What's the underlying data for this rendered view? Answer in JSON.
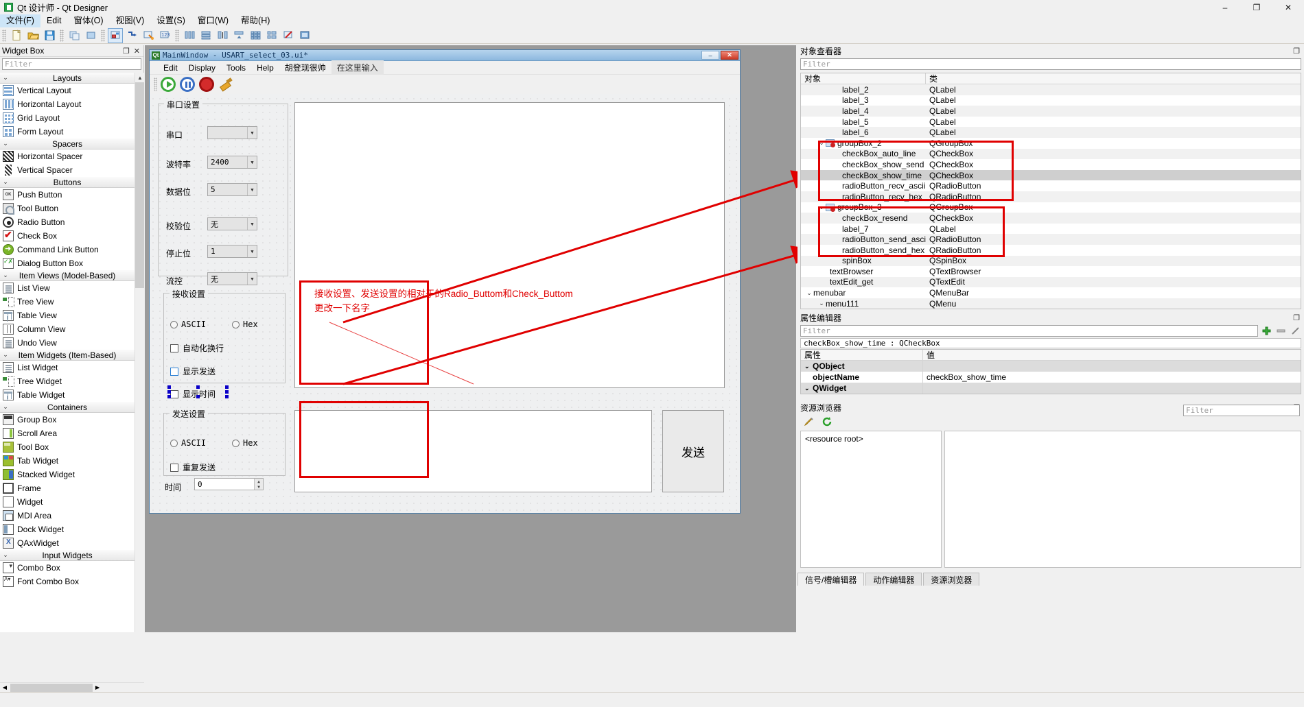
{
  "window": {
    "title": "Qt 设计师 - Qt Designer",
    "app_icon": "qt-designer-icon",
    "minimize": "–",
    "maximize": "❐",
    "close": "✕"
  },
  "menubar": [
    {
      "label": "文件(F)",
      "active": true
    },
    {
      "label": "Edit",
      "active": false
    },
    {
      "label": "窗体(O)",
      "active": false
    },
    {
      "label": "视图(V)",
      "active": false
    },
    {
      "label": "设置(S)",
      "active": false
    },
    {
      "label": "窗口(W)",
      "active": false
    },
    {
      "label": "帮助(H)",
      "active": false
    }
  ],
  "widget_box": {
    "title": "Widget Box",
    "float_btn": "❐",
    "close_btn": "✕",
    "filter_placeholder": "Filter",
    "categories": [
      {
        "label": "Layouts",
        "chevron": "⌄",
        "items": [
          {
            "label": "Vertical Layout",
            "icon": "vertical-layout-icon",
            "cls": "ic-vlayout"
          },
          {
            "label": "Horizontal Layout",
            "icon": "horizontal-layout-icon",
            "cls": "ic-hlayout"
          },
          {
            "label": "Grid Layout",
            "icon": "grid-layout-icon",
            "cls": "ic-grid"
          },
          {
            "label": "Form Layout",
            "icon": "form-layout-icon",
            "cls": "ic-form"
          }
        ]
      },
      {
        "label": "Spacers",
        "chevron": "⌄",
        "items": [
          {
            "label": "Horizontal Spacer",
            "icon": "horizontal-spacer-icon",
            "cls": "ic-hspacer"
          },
          {
            "label": "Vertical Spacer",
            "icon": "vertical-spacer-icon",
            "cls": "ic-vspacer"
          }
        ]
      },
      {
        "label": "Buttons",
        "chevron": "⌄",
        "items": [
          {
            "label": "Push Button",
            "icon": "push-button-icon",
            "cls": "ic-push",
            "glyph": "OK"
          },
          {
            "label": "Tool Button",
            "icon": "tool-button-icon",
            "cls": "ic-tool"
          },
          {
            "label": "Radio Button",
            "icon": "radio-button-icon",
            "cls": "ic-radio"
          },
          {
            "label": "Check Box",
            "icon": "check-box-icon",
            "cls": "ic-check"
          },
          {
            "label": "Command Link Button",
            "icon": "command-link-button-icon",
            "cls": "ic-cmd"
          },
          {
            "label": "Dialog Button Box",
            "icon": "dialog-button-box-icon",
            "cls": "ic-dlg"
          }
        ]
      },
      {
        "label": "Item Views (Model-Based)",
        "chevron": "⌄",
        "items": [
          {
            "label": "List View",
            "icon": "list-view-icon",
            "cls": "ic-listv"
          },
          {
            "label": "Tree View",
            "icon": "tree-view-icon",
            "cls": "ic-treev"
          },
          {
            "label": "Table View",
            "icon": "table-view-icon",
            "cls": "ic-tablev"
          },
          {
            "label": "Column View",
            "icon": "column-view-icon",
            "cls": "ic-colv"
          },
          {
            "label": "Undo View",
            "icon": "undo-view-icon",
            "cls": "ic-listv"
          }
        ]
      },
      {
        "label": "Item Widgets (Item-Based)",
        "chevron": "⌄",
        "items": [
          {
            "label": "List Widget",
            "icon": "list-widget-icon",
            "cls": "ic-listv"
          },
          {
            "label": "Tree Widget",
            "icon": "tree-widget-icon",
            "cls": "ic-treev"
          },
          {
            "label": "Table Widget",
            "icon": "table-widget-icon",
            "cls": "ic-tablev"
          }
        ]
      },
      {
        "label": "Containers",
        "chevron": "⌄",
        "items": [
          {
            "label": "Group Box",
            "icon": "group-box-icon",
            "cls": "ic-group"
          },
          {
            "label": "Scroll Area",
            "icon": "scroll-area-icon",
            "cls": "ic-scroll"
          },
          {
            "label": "Tool Box",
            "icon": "tool-box-icon",
            "cls": "ic-toolbox"
          },
          {
            "label": "Tab Widget",
            "icon": "tab-widget-icon",
            "cls": "ic-tab"
          },
          {
            "label": "Stacked Widget",
            "icon": "stacked-widget-icon",
            "cls": "ic-stacked"
          },
          {
            "label": "Frame",
            "icon": "frame-icon",
            "cls": "ic-frame"
          },
          {
            "label": "Widget",
            "icon": "widget-icon",
            "cls": "ic-widget"
          },
          {
            "label": "MDI Area",
            "icon": "mdi-area-icon",
            "cls": "ic-mdi"
          },
          {
            "label": "Dock Widget",
            "icon": "dock-widget-icon",
            "cls": "ic-dock"
          },
          {
            "label": "QAxWidget",
            "icon": "qaxwidget-icon",
            "cls": "ic-qax"
          }
        ]
      },
      {
        "label": "Input Widgets",
        "chevron": "⌄",
        "items": [
          {
            "label": "Combo Box",
            "icon": "combo-box-icon",
            "cls": "ic-combo"
          },
          {
            "label": "Font Combo Box",
            "icon": "font-combo-box-icon",
            "cls": "ic-fcombo"
          }
        ]
      }
    ]
  },
  "form_window": {
    "title": "MainWindow - USART_select_03.ui*",
    "qt_badge": "Qt",
    "minimize": "–",
    "close": "✕",
    "menus": [
      {
        "label": "Edit",
        "placeholder": false
      },
      {
        "label": "Display",
        "placeholder": false
      },
      {
        "label": "Tools",
        "placeholder": false
      },
      {
        "label": "Help",
        "placeholder": false
      },
      {
        "label": "胡登现很帅",
        "placeholder": false
      },
      {
        "label": "在这里输入",
        "placeholder": true
      }
    ],
    "toolbar": [
      {
        "name": "play-button",
        "icon": "play-icon"
      },
      {
        "name": "pause-button",
        "icon": "pause-icon"
      },
      {
        "name": "stop-button",
        "icon": "record-stop-icon"
      },
      {
        "name": "clear-button",
        "icon": "broom-icon"
      }
    ],
    "serial_group": {
      "title": "串口设置",
      "rows": [
        {
          "label": "串口",
          "value": ""
        },
        {
          "label": "波特率",
          "value": "2400"
        },
        {
          "label": "数据位",
          "value": "5"
        },
        {
          "label": "校验位",
          "value": "无"
        },
        {
          "label": "停止位",
          "value": "1"
        },
        {
          "label": "流控",
          "value": "无"
        }
      ]
    },
    "recv_group": {
      "title": "接收设置",
      "radio_ascii": "ASCII",
      "radio_hex": "Hex",
      "check_auto_line": "自动化换行",
      "check_show_send": "显示发送",
      "check_show_time": "显示时间"
    },
    "send_group": {
      "title": "发送设置",
      "radio_ascii": "ASCII",
      "radio_hex": "Hex",
      "check_resend": "重复发送"
    },
    "time_row": {
      "label": "时间",
      "value": "0",
      "up": "▲",
      "down": "▼"
    },
    "send_button": "发送"
  },
  "annotations": {
    "note_line1": "接收设置、发送设置的相对于的Radio_Buttom和Check_Buttom",
    "note_line2": "更改一下名字",
    "color": "#e00000"
  },
  "object_inspector": {
    "title": "对象查看器",
    "float_btn": "❐",
    "filter_placeholder": "Filter",
    "columns": [
      "对象",
      "类"
    ],
    "rows": [
      {
        "name": "label_2",
        "cls": "QLabel",
        "indent": 3,
        "chevron": "",
        "group": false,
        "selected": false,
        "alt": true
      },
      {
        "name": "label_3",
        "cls": "QLabel",
        "indent": 3,
        "chevron": "",
        "group": false,
        "selected": false,
        "alt": false
      },
      {
        "name": "label_4",
        "cls": "QLabel",
        "indent": 3,
        "chevron": "",
        "group": false,
        "selected": false,
        "alt": true
      },
      {
        "name": "label_5",
        "cls": "QLabel",
        "indent": 3,
        "chevron": "",
        "group": false,
        "selected": false,
        "alt": false
      },
      {
        "name": "label_6",
        "cls": "QLabel",
        "indent": 3,
        "chevron": "",
        "group": false,
        "selected": false,
        "alt": true
      },
      {
        "name": "groupBox_2",
        "cls": "QGroupBox",
        "indent": 2,
        "chevron": "⌄",
        "group": true,
        "selected": false,
        "alt": false
      },
      {
        "name": "checkBox_auto_line",
        "cls": "QCheckBox",
        "indent": 3,
        "chevron": "",
        "group": false,
        "selected": false,
        "alt": true
      },
      {
        "name": "checkBox_show_send",
        "cls": "QCheckBox",
        "indent": 3,
        "chevron": "",
        "group": false,
        "selected": false,
        "alt": false
      },
      {
        "name": "checkBox_show_time",
        "cls": "QCheckBox",
        "indent": 3,
        "chevron": "",
        "group": false,
        "selected": true,
        "alt": false
      },
      {
        "name": "radioButton_recv_ascii",
        "cls": "QRadioButton",
        "indent": 3,
        "chevron": "",
        "group": false,
        "selected": false,
        "alt": false
      },
      {
        "name": "radioButton_recv_hex",
        "cls": "QRadioButton",
        "indent": 3,
        "chevron": "",
        "group": false,
        "selected": false,
        "alt": true
      },
      {
        "name": "groupBox_3",
        "cls": "QGroupBox",
        "indent": 2,
        "chevron": "⌄",
        "group": true,
        "selected": false,
        "alt": false
      },
      {
        "name": "checkBox_resend",
        "cls": "QCheckBox",
        "indent": 3,
        "chevron": "",
        "group": false,
        "selected": false,
        "alt": true
      },
      {
        "name": "label_7",
        "cls": "QLabel",
        "indent": 3,
        "chevron": "",
        "group": false,
        "selected": false,
        "alt": false
      },
      {
        "name": "radioButton_send_ascii",
        "cls": "QRadioButton",
        "indent": 3,
        "chevron": "",
        "group": false,
        "selected": false,
        "alt": true
      },
      {
        "name": "radioButton_send_hex",
        "cls": "QRadioButton",
        "indent": 3,
        "chevron": "",
        "group": false,
        "selected": false,
        "alt": false
      },
      {
        "name": "spinBox",
        "cls": "QSpinBox",
        "indent": 3,
        "chevron": "",
        "group": false,
        "selected": false,
        "alt": true
      },
      {
        "name": "textBrowser",
        "cls": "QTextBrowser",
        "indent": 2,
        "chevron": "",
        "group": false,
        "selected": false,
        "alt": false
      },
      {
        "name": "textEdit_get",
        "cls": "QTextEdit",
        "indent": 2,
        "chevron": "",
        "group": false,
        "selected": false,
        "alt": true
      },
      {
        "name": "menubar",
        "cls": "QMenuBar",
        "indent": 1,
        "chevron": "⌄",
        "group": false,
        "selected": false,
        "alt": false
      },
      {
        "name": "menu111",
        "cls": "QMenu",
        "indent": 2,
        "chevron": "⌄",
        "group": false,
        "selected": false,
        "alt": true
      }
    ]
  },
  "property_editor": {
    "title": "属性编辑器",
    "float_btn": "❐",
    "filter_placeholder": "Filter",
    "add_icon": "plus-icon",
    "remove_icon": "minus-icon",
    "config_icon": "wrench-icon",
    "object_line": "checkBox_show_time : QCheckBox",
    "columns": [
      "属性",
      "值"
    ],
    "rows": [
      {
        "name": "QObject",
        "value": "",
        "group": true,
        "chevron": "⌄",
        "bold": false
      },
      {
        "name": "objectName",
        "value": "checkBox_show_time",
        "group": false,
        "chevron": "",
        "bold": true
      },
      {
        "name": "QWidget",
        "value": "",
        "group": true,
        "chevron": "⌄",
        "bold": false
      }
    ]
  },
  "resource_browser": {
    "title": "资源浏览器",
    "float_btn": "❐",
    "edit_icon": "pencil-icon",
    "reload_icon": "refresh-icon",
    "filter_placeholder": "Filter",
    "root_label": "<resource root>"
  },
  "bottom_tabs": [
    {
      "label": "信号/槽编辑器",
      "active": true
    },
    {
      "label": "动作编辑器",
      "active": false
    },
    {
      "label": "资源浏览器",
      "active": false
    }
  ]
}
